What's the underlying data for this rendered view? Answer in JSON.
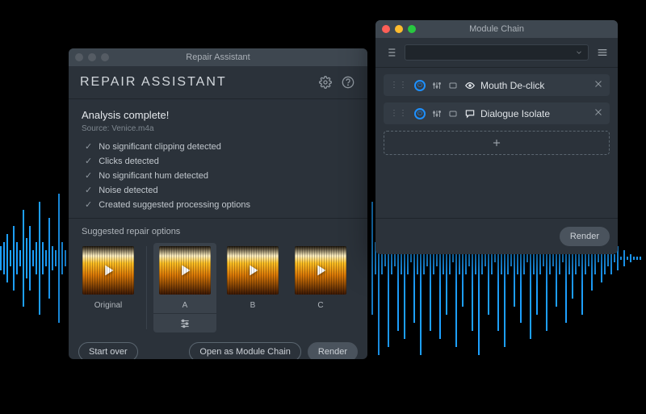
{
  "repair": {
    "window_title": "Repair Assistant",
    "header": "REPAIR ASSISTANT",
    "status_title": "Analysis complete!",
    "source_prefix": "Source: ",
    "source_file": "Venice.m4a",
    "bullets": [
      "No significant clipping detected",
      "Clicks detected",
      "No significant hum detected",
      "Noise detected",
      "Created suggested processing options"
    ],
    "section_label": "Suggested repair options",
    "options": {
      "original": "Original",
      "a": "A",
      "b": "B",
      "c": "C",
      "selected": "A"
    },
    "footer": {
      "start_over": "Start over",
      "open_chain": "Open as Module Chain",
      "render": "Render"
    }
  },
  "module_chain": {
    "window_title": "Module Chain",
    "rows": [
      {
        "name": "Mouth De-click",
        "icon": "mouth"
      },
      {
        "name": "Dialogue Isolate",
        "icon": "dialogue"
      }
    ],
    "footer": {
      "render": "Render"
    }
  },
  "colors": {
    "panel": "#2b323a",
    "accent": "#1e90ff",
    "waveform": "#1da0ff"
  }
}
